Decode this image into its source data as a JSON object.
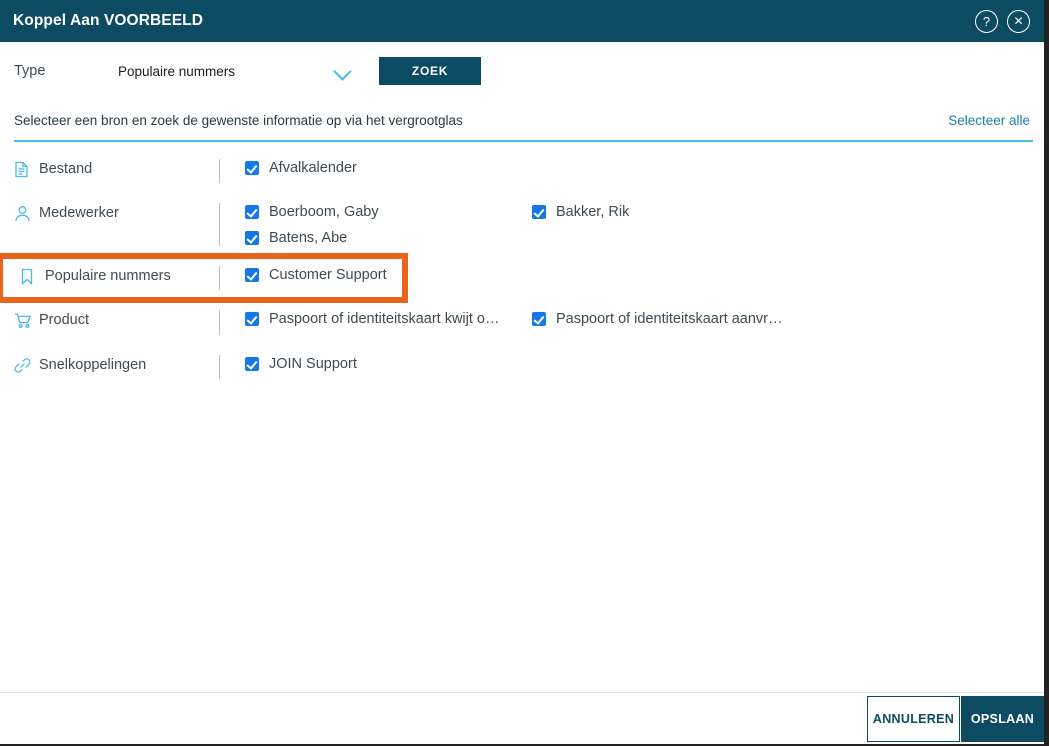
{
  "window": {
    "title": "Koppel Aan VOORBEELD",
    "help_icon": "question-mark-circle-icon",
    "close_icon": "close-circle-icon",
    "help_glyph": "?",
    "close_glyph": "✕"
  },
  "search": {
    "type_label": "Type",
    "type_value": "Populaire nummers",
    "dropdown_icon": "chevron-down-icon",
    "search_button": "ZOEK"
  },
  "instruction": {
    "text": "Selecteer een bron en zoek de gewenste informatie op via het vergrootglas",
    "select_all": "Selecteer alle"
  },
  "rows": [
    {
      "label": "Bestand",
      "icon": "document-icon",
      "highlighted": false,
      "items": [
        {
          "label": "Afvalkalender",
          "checked": true
        }
      ]
    },
    {
      "label": "Medewerker",
      "icon": "person-icon",
      "highlighted": false,
      "items": [
        {
          "label": "Boerboom, Gaby",
          "checked": true
        },
        {
          "label": "Bakker, Rik",
          "checked": true
        },
        {
          "label": "Batens, Abe",
          "checked": true
        }
      ]
    },
    {
      "label": "Populaire nummers",
      "icon": "bookmark-icon",
      "highlighted": true,
      "items": [
        {
          "label": "Customer Support",
          "checked": true
        }
      ]
    },
    {
      "label": "Product",
      "icon": "shopping-cart-icon",
      "highlighted": false,
      "items": [
        {
          "label": "Paspoort of identiteitskaart kwijt o…",
          "checked": true
        },
        {
          "label": "Paspoort of identiteitskaart aanvr…",
          "checked": true
        }
      ]
    },
    {
      "label": "Snelkoppelingen",
      "icon": "link-icon",
      "highlighted": false,
      "items": [
        {
          "label": "JOIN Support",
          "checked": true
        }
      ]
    }
  ],
  "footer": {
    "cancel_label": "ANNULEREN",
    "save_label": "OPSLAAN"
  },
  "colors": {
    "header_bg": "#0d4b63",
    "accent_blue": "#4ab8e8",
    "link_blue": "#1a7fa8",
    "checkbox_blue": "#1578ea",
    "highlight_orange": "#e8641b",
    "text": "#3e4b52"
  }
}
